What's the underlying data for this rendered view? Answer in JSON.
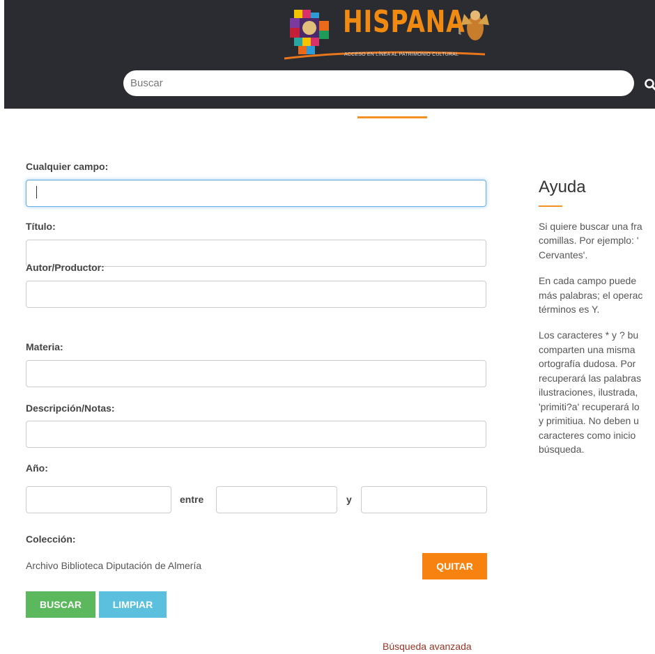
{
  "header": {
    "logo_title": "HISPANA",
    "logo_tagline": "ACCESO EN LÍNEA AL PATRIMONIO CULTURAL",
    "search_placeholder": "Buscar"
  },
  "form": {
    "any_field_label": "Cualquier campo:",
    "any_field_value": "",
    "title_label": "Título:",
    "author_label": "Autor/Productor:",
    "subject_label": "Materia:",
    "description_label": "Descripción/Notas:",
    "year_label": "Año:",
    "year_between": "entre",
    "year_and": "y",
    "collection_label": "Colección:",
    "collection_name": "Archivo Biblioteca Diputación de Almería",
    "remove_button": "QUITAR",
    "search_button": "BUSCAR",
    "clear_button": "LIMPIAR",
    "advanced_link": "Búsqueda avanzada"
  },
  "help": {
    "title": "Ayuda",
    "p1": [
      "Si quiere buscar una fra",
      "comillas. Por ejemplo: '",
      "Cervantes'."
    ],
    "p2": [
      "En cada campo puede",
      "más palabras; el operac",
      "términos es Y."
    ],
    "p3": [
      "Los caracteres * y ? bu",
      "comparten una misma",
      "ortografía dudosa. Por",
      "recuperará las palabras",
      "ilustraciones, ilustrada,",
      "'primiti?a' recuperará lo",
      "y primitiua. No deben u",
      "caracteres como inicio",
      "búsqueda."
    ]
  },
  "colors": {
    "header_bg": "#2b2b32",
    "accent_orange": "#f39223",
    "search_button_green": "#5cb85c",
    "clear_button_blue": "#5bc0de",
    "remove_button_orange": "#f7820f",
    "link_red": "#9a3324"
  },
  "icons": {
    "search": "magnifier-icon",
    "logo_mosaic": "mosaic-icon",
    "logo_figure": "angel-figure-icon"
  }
}
